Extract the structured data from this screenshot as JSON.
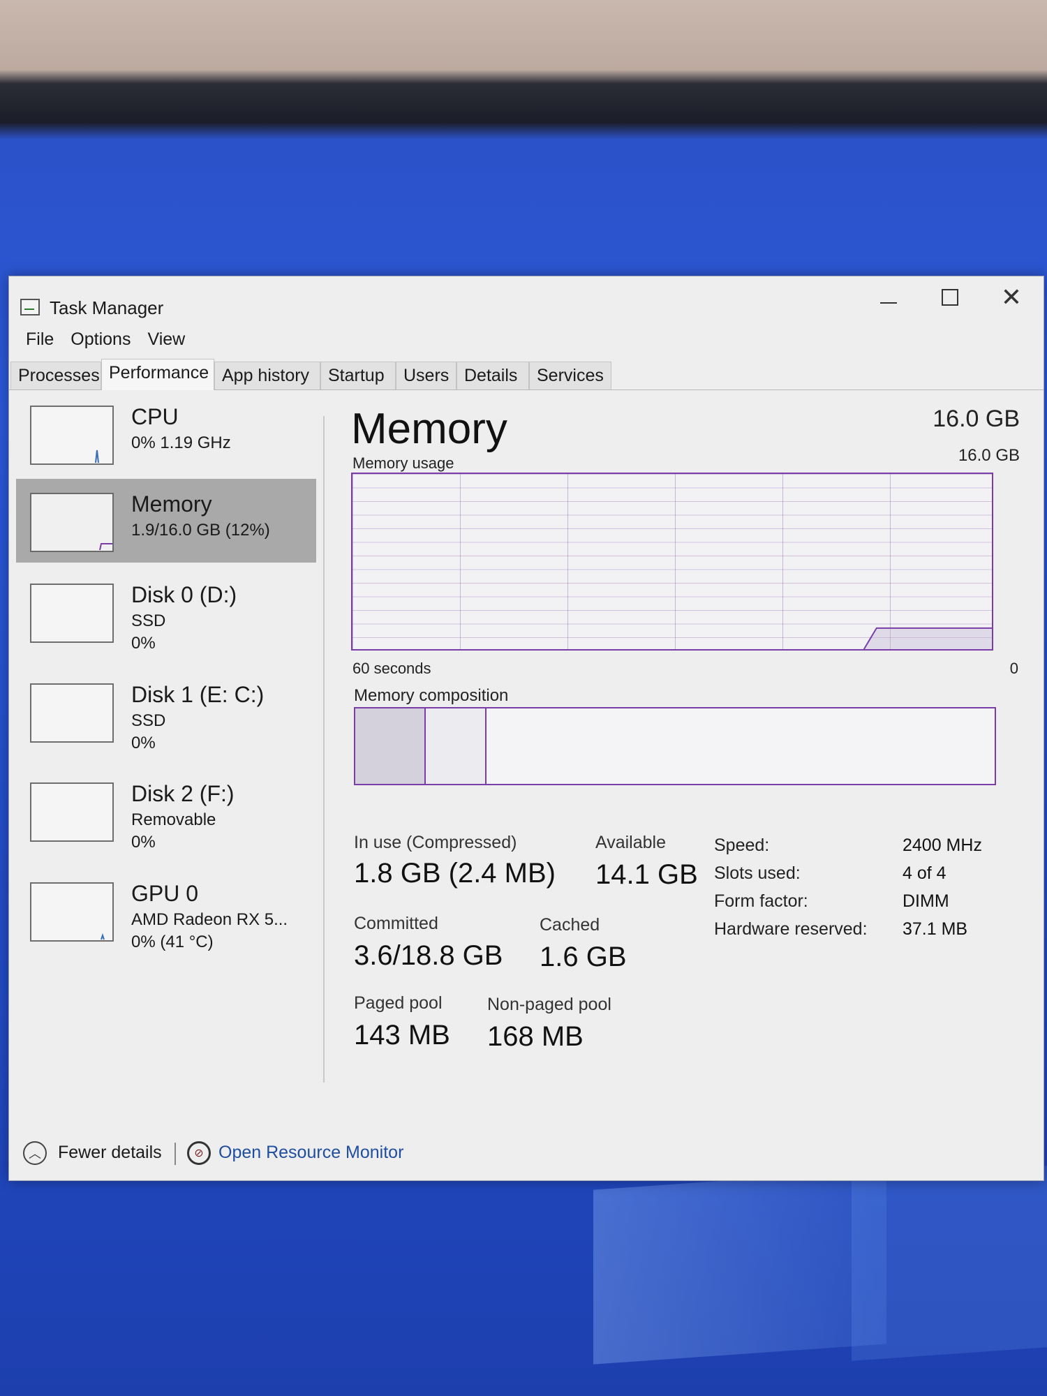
{
  "window": {
    "title": "Task Manager"
  },
  "menu": [
    "File",
    "Options",
    "View"
  ],
  "tabs": [
    "Processes",
    "Performance",
    "App history",
    "Startup",
    "Users",
    "Details",
    "Services"
  ],
  "sidebar": {
    "items": [
      {
        "name": "CPU",
        "line1": "0% 1.19 GHz",
        "line2": ""
      },
      {
        "name": "Memory",
        "line1": "1.9/16.0 GB (12%)",
        "line2": ""
      },
      {
        "name": "Disk 0 (D:)",
        "line1": "SSD",
        "line2": "0%"
      },
      {
        "name": "Disk 1 (E: C:)",
        "line1": "SSD",
        "line2": "0%"
      },
      {
        "name": "Disk 2 (F:)",
        "line1": "Removable",
        "line2": "0%"
      },
      {
        "name": "GPU 0",
        "line1": "AMD Radeon RX 5...",
        "line2": "0% (41 °C)"
      }
    ]
  },
  "memory": {
    "title": "Memory",
    "total": "16.0 GB",
    "usage_label": "Memory usage",
    "usage_max": "16.0 GB",
    "axis_left": "60 seconds",
    "axis_right": "0",
    "composition_label": "Memory composition",
    "usage_fraction": 0.12,
    "composition": {
      "in_use_fraction": 0.11,
      "modified_fraction": 0.095
    },
    "stats": {
      "in_use_label": "In use (Compressed)",
      "in_use_value": "1.8 GB (2.4 MB)",
      "available_label": "Available",
      "available_value": "14.1 GB",
      "committed_label": "Committed",
      "committed_value": "3.6/18.8 GB",
      "cached_label": "Cached",
      "cached_value": "1.6 GB",
      "paged_label": "Paged pool",
      "paged_value": "143 MB",
      "nonpaged_label": "Non-paged pool",
      "nonpaged_value": "168 MB"
    },
    "specs": {
      "speed_label": "Speed:",
      "speed_value": "2400 MHz",
      "slots_label": "Slots used:",
      "slots_value": "4 of 4",
      "form_label": "Form factor:",
      "form_value": "DIMM",
      "hw_label": "Hardware reserved:",
      "hw_value": "37.1 MB"
    }
  },
  "footer": {
    "fewer_details": "Fewer details",
    "resource_monitor": "Open Resource Monitor"
  },
  "colors": {
    "accent": "#7b3ea8",
    "link": "#1f4e9e",
    "selected_bg": "#a9a9a9"
  }
}
